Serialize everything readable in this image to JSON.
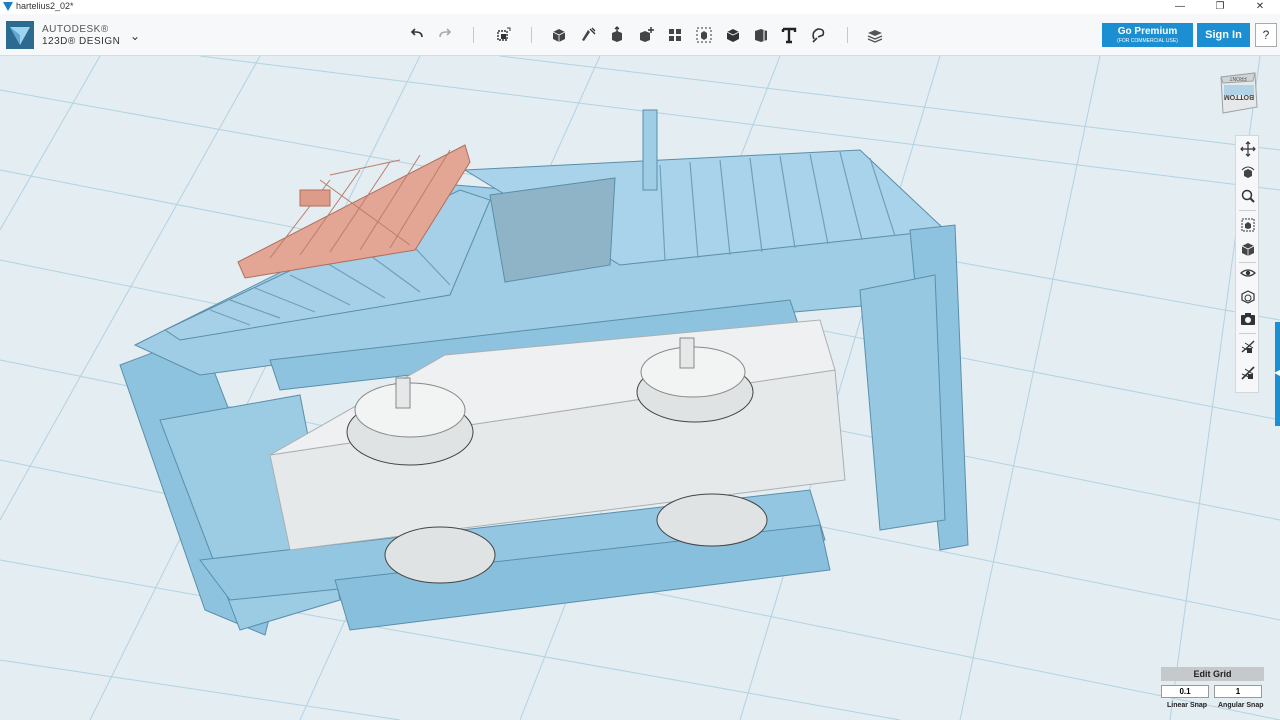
{
  "window": {
    "title": "hartelius2_02*",
    "controls": [
      "—",
      "❐",
      "✕"
    ]
  },
  "app": {
    "brand_line1": "AUTODESK®",
    "brand_line2": "123D® DESIGN",
    "menu_chevron": "⌄"
  },
  "toolbar": {
    "icons": [
      "undo-icon",
      "redo-icon",
      "transform-icon",
      "primitives-icon",
      "sketch-icon",
      "construct-icon",
      "modify-icon",
      "pattern-icon",
      "group-icon",
      "combine-icon",
      "measure-icon",
      "text-icon",
      "snap-icon",
      "material-icon"
    ]
  },
  "header_buttons": {
    "premium_label": "Go Premium",
    "premium_sub": "(FOR COMMERCIAL USE)",
    "signin_label": "Sign In",
    "help_label": "?"
  },
  "viewcube": {
    "face_label": "BOTTOM",
    "top_label": "FRONT"
  },
  "nav_panel": {
    "icons": [
      "pan-icon",
      "orbit-icon",
      "zoom-icon",
      "fit-icon",
      "view-icon",
      "visibility-icon",
      "materials-outlines-icon",
      "camera-icon",
      "grid-snap-icon",
      "hide-icon"
    ]
  },
  "grid": {
    "edit_label": "Edit Grid",
    "linear_snap_value": "0.1",
    "angular_snap_value": "1",
    "linear_snap_label": "Linear Snap",
    "angular_snap_label": "Angular Snap"
  },
  "colors": {
    "accent": "#1b8fd1",
    "model_blue": "#8ec3df",
    "model_salmon": "#e3a594",
    "model_white": "#e6e9ea",
    "viewport_bg": "#e3edf2"
  }
}
